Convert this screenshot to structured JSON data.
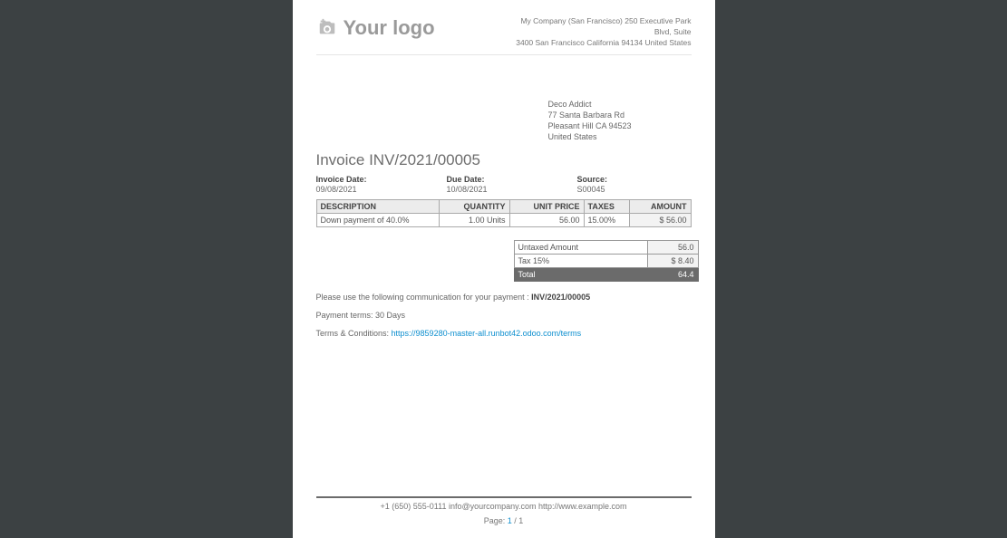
{
  "header": {
    "logo_text": "Your logo",
    "company_line1": "My Company (San Francisco) 250 Executive Park Blvd, Suite",
    "company_line2": "3400 San Francisco California 94134 United States"
  },
  "customer": {
    "name": "Deco Addict",
    "street": "77 Santa Barbara Rd",
    "city": "Pleasant Hill CA 94523",
    "country": "United States"
  },
  "document": {
    "title": "Invoice INV/2021/00005"
  },
  "meta": {
    "invoice_date_label": "Invoice Date:",
    "invoice_date": "09/08/2021",
    "due_date_label": "Due Date:",
    "due_date": "10/08/2021",
    "source_label": "Source:",
    "source": "S00045"
  },
  "columns": {
    "description": "DESCRIPTION",
    "quantity": "QUANTITY",
    "unit_price": "UNIT PRICE",
    "taxes": "TAXES",
    "amount": "AMOUNT"
  },
  "rows": [
    {
      "description": "Down payment of 40.0%",
      "quantity": "1.00 Units",
      "unit_price": "56.00",
      "taxes": "15.00%",
      "amount": "$ 56.00"
    }
  ],
  "totals": {
    "untaxed_label": "Untaxed Amount",
    "untaxed_value": "56.0",
    "tax_label": "Tax 15%",
    "tax_value": "$ 8.40",
    "total_label": "Total",
    "total_value": "64.4"
  },
  "notes": {
    "comm_prefix": "Please use the following communication for your payment : ",
    "comm_ref": "INV/2021/00005",
    "terms": "Payment terms: 30 Days",
    "tc_prefix": "Terms & Conditions: ",
    "tc_link": "https://9859280-master-all.runbot42.odoo.com/terms"
  },
  "footer": {
    "line": "+1 (650) 555-0111 info@yourcompany.com http://www.example.com",
    "page_label": "Page: ",
    "page_current": "1",
    "page_sep": " / ",
    "page_total": "1"
  }
}
